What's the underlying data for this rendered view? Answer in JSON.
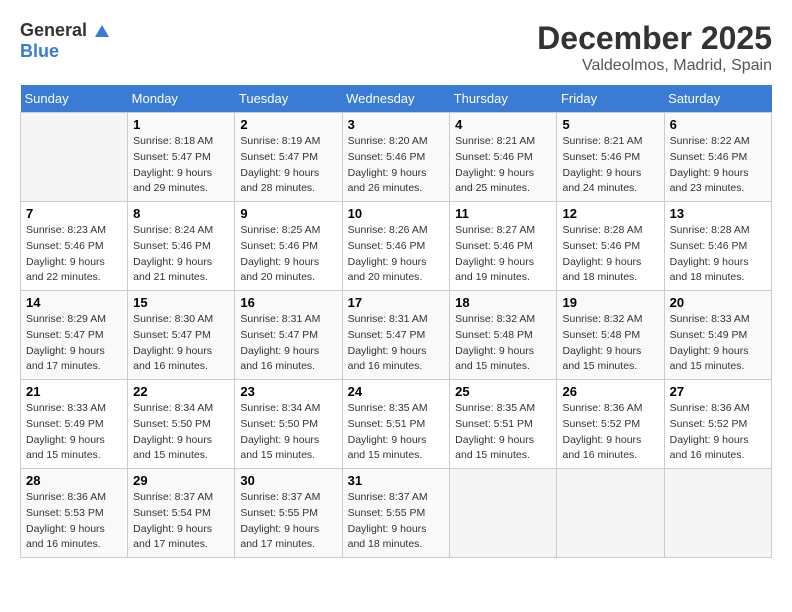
{
  "header": {
    "logo_general": "General",
    "logo_blue": "Blue",
    "month": "December 2025",
    "location": "Valdeolmos, Madrid, Spain"
  },
  "days_of_week": [
    "Sunday",
    "Monday",
    "Tuesday",
    "Wednesday",
    "Thursday",
    "Friday",
    "Saturday"
  ],
  "weeks": [
    [
      {
        "day": "",
        "info": ""
      },
      {
        "day": "1",
        "info": "Sunrise: 8:18 AM\nSunset: 5:47 PM\nDaylight: 9 hours\nand 29 minutes."
      },
      {
        "day": "2",
        "info": "Sunrise: 8:19 AM\nSunset: 5:47 PM\nDaylight: 9 hours\nand 28 minutes."
      },
      {
        "day": "3",
        "info": "Sunrise: 8:20 AM\nSunset: 5:46 PM\nDaylight: 9 hours\nand 26 minutes."
      },
      {
        "day": "4",
        "info": "Sunrise: 8:21 AM\nSunset: 5:46 PM\nDaylight: 9 hours\nand 25 minutes."
      },
      {
        "day": "5",
        "info": "Sunrise: 8:21 AM\nSunset: 5:46 PM\nDaylight: 9 hours\nand 24 minutes."
      },
      {
        "day": "6",
        "info": "Sunrise: 8:22 AM\nSunset: 5:46 PM\nDaylight: 9 hours\nand 23 minutes."
      }
    ],
    [
      {
        "day": "7",
        "info": "Sunrise: 8:23 AM\nSunset: 5:46 PM\nDaylight: 9 hours\nand 22 minutes."
      },
      {
        "day": "8",
        "info": "Sunrise: 8:24 AM\nSunset: 5:46 PM\nDaylight: 9 hours\nand 21 minutes."
      },
      {
        "day": "9",
        "info": "Sunrise: 8:25 AM\nSunset: 5:46 PM\nDaylight: 9 hours\nand 20 minutes."
      },
      {
        "day": "10",
        "info": "Sunrise: 8:26 AM\nSunset: 5:46 PM\nDaylight: 9 hours\nand 20 minutes."
      },
      {
        "day": "11",
        "info": "Sunrise: 8:27 AM\nSunset: 5:46 PM\nDaylight: 9 hours\nand 19 minutes."
      },
      {
        "day": "12",
        "info": "Sunrise: 8:28 AM\nSunset: 5:46 PM\nDaylight: 9 hours\nand 18 minutes."
      },
      {
        "day": "13",
        "info": "Sunrise: 8:28 AM\nSunset: 5:46 PM\nDaylight: 9 hours\nand 18 minutes."
      }
    ],
    [
      {
        "day": "14",
        "info": "Sunrise: 8:29 AM\nSunset: 5:47 PM\nDaylight: 9 hours\nand 17 minutes."
      },
      {
        "day": "15",
        "info": "Sunrise: 8:30 AM\nSunset: 5:47 PM\nDaylight: 9 hours\nand 16 minutes."
      },
      {
        "day": "16",
        "info": "Sunrise: 8:31 AM\nSunset: 5:47 PM\nDaylight: 9 hours\nand 16 minutes."
      },
      {
        "day": "17",
        "info": "Sunrise: 8:31 AM\nSunset: 5:47 PM\nDaylight: 9 hours\nand 16 minutes."
      },
      {
        "day": "18",
        "info": "Sunrise: 8:32 AM\nSunset: 5:48 PM\nDaylight: 9 hours\nand 15 minutes."
      },
      {
        "day": "19",
        "info": "Sunrise: 8:32 AM\nSunset: 5:48 PM\nDaylight: 9 hours\nand 15 minutes."
      },
      {
        "day": "20",
        "info": "Sunrise: 8:33 AM\nSunset: 5:49 PM\nDaylight: 9 hours\nand 15 minutes."
      }
    ],
    [
      {
        "day": "21",
        "info": "Sunrise: 8:33 AM\nSunset: 5:49 PM\nDaylight: 9 hours\nand 15 minutes."
      },
      {
        "day": "22",
        "info": "Sunrise: 8:34 AM\nSunset: 5:50 PM\nDaylight: 9 hours\nand 15 minutes."
      },
      {
        "day": "23",
        "info": "Sunrise: 8:34 AM\nSunset: 5:50 PM\nDaylight: 9 hours\nand 15 minutes."
      },
      {
        "day": "24",
        "info": "Sunrise: 8:35 AM\nSunset: 5:51 PM\nDaylight: 9 hours\nand 15 minutes."
      },
      {
        "day": "25",
        "info": "Sunrise: 8:35 AM\nSunset: 5:51 PM\nDaylight: 9 hours\nand 15 minutes."
      },
      {
        "day": "26",
        "info": "Sunrise: 8:36 AM\nSunset: 5:52 PM\nDaylight: 9 hours\nand 16 minutes."
      },
      {
        "day": "27",
        "info": "Sunrise: 8:36 AM\nSunset: 5:52 PM\nDaylight: 9 hours\nand 16 minutes."
      }
    ],
    [
      {
        "day": "28",
        "info": "Sunrise: 8:36 AM\nSunset: 5:53 PM\nDaylight: 9 hours\nand 16 minutes."
      },
      {
        "day": "29",
        "info": "Sunrise: 8:37 AM\nSunset: 5:54 PM\nDaylight: 9 hours\nand 17 minutes."
      },
      {
        "day": "30",
        "info": "Sunrise: 8:37 AM\nSunset: 5:55 PM\nDaylight: 9 hours\nand 17 minutes."
      },
      {
        "day": "31",
        "info": "Sunrise: 8:37 AM\nSunset: 5:55 PM\nDaylight: 9 hours\nand 18 minutes."
      },
      {
        "day": "",
        "info": ""
      },
      {
        "day": "",
        "info": ""
      },
      {
        "day": "",
        "info": ""
      }
    ]
  ]
}
